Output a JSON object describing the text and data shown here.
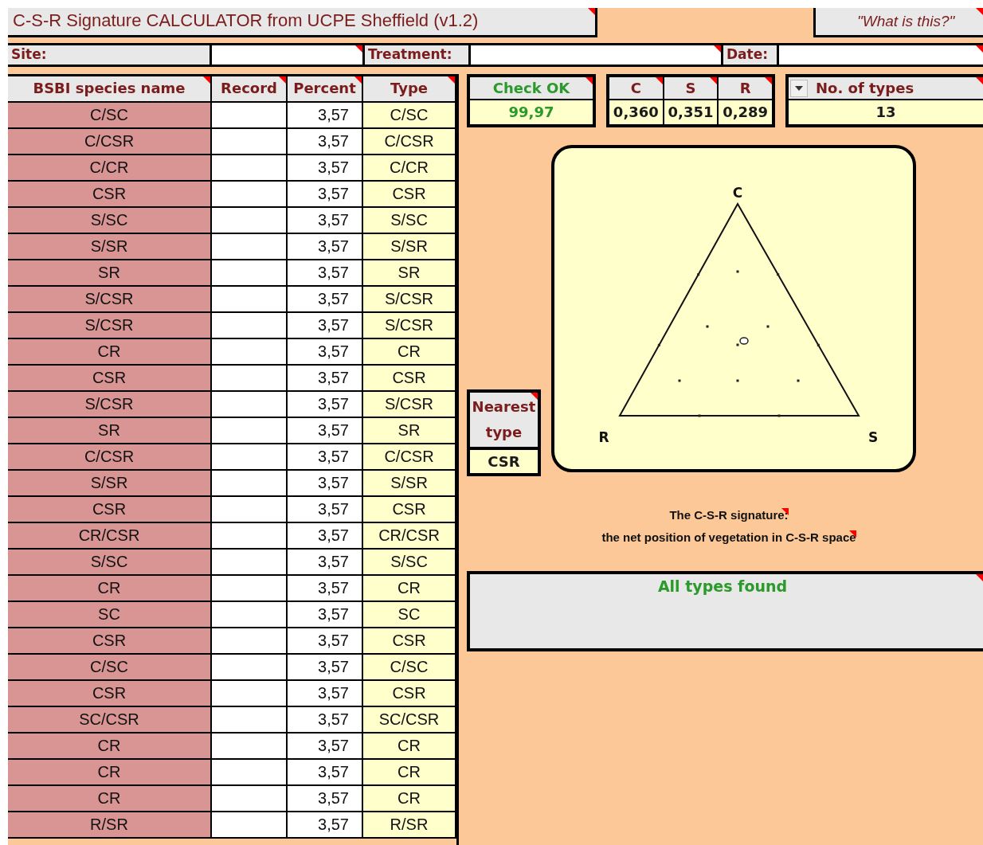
{
  "title": {
    "text": "C-S-R Signature CALCULATOR from UCPE Sheffield (v1.2)",
    "comment": true
  },
  "help_button": {
    "text": "\"What is this?\"",
    "comment": true
  },
  "fields": [
    {
      "label": "Site:",
      "comment": true
    },
    {
      "label": "Treatment:",
      "comment": true
    },
    {
      "label": "Date:",
      "comment": true
    }
  ],
  "table": {
    "columns": [
      {
        "label": "BSBI species name",
        "comment": true
      },
      {
        "label": "Record",
        "comment": true
      },
      {
        "label": "Percent",
        "comment": true
      },
      {
        "label": "Type",
        "comment": true
      }
    ],
    "rows": [
      {
        "name": "C/SC",
        "percent": "3,57",
        "type": "C/SC"
      },
      {
        "name": "C/CSR",
        "percent": "3,57",
        "type": "C/CSR"
      },
      {
        "name": "C/CR",
        "percent": "3,57",
        "type": "C/CR"
      },
      {
        "name": "CSR",
        "percent": "3,57",
        "type": "CSR"
      },
      {
        "name": "S/SC",
        "percent": "3,57",
        "type": "S/SC"
      },
      {
        "name": "S/SR",
        "percent": "3,57",
        "type": "S/SR"
      },
      {
        "name": "SR",
        "percent": "3,57",
        "type": "SR"
      },
      {
        "name": "S/CSR",
        "percent": "3,57",
        "type": "S/CSR"
      },
      {
        "name": "S/CSR",
        "percent": "3,57",
        "type": "S/CSR"
      },
      {
        "name": "CR",
        "percent": "3,57",
        "type": "CR"
      },
      {
        "name": "CSR",
        "percent": "3,57",
        "type": "CSR"
      },
      {
        "name": "S/CSR",
        "percent": "3,57",
        "type": "S/CSR"
      },
      {
        "name": "SR",
        "percent": "3,57",
        "type": "SR"
      },
      {
        "name": "C/CSR",
        "percent": "3,57",
        "type": "C/CSR"
      },
      {
        "name": "S/SR",
        "percent": "3,57",
        "type": "S/SR"
      },
      {
        "name": "CSR",
        "percent": "3,57",
        "type": "CSR"
      },
      {
        "name": "CR/CSR",
        "percent": "3,57",
        "type": "CR/CSR"
      },
      {
        "name": "S/SC",
        "percent": "3,57",
        "type": "S/SC"
      },
      {
        "name": "CR",
        "percent": "3,57",
        "type": "CR"
      },
      {
        "name": "SC",
        "percent": "3,57",
        "type": "SC"
      },
      {
        "name": "CSR",
        "percent": "3,57",
        "type": "CSR"
      },
      {
        "name": "C/SC",
        "percent": "3,57",
        "type": "C/SC"
      },
      {
        "name": "CSR",
        "percent": "3,57",
        "type": "CSR"
      },
      {
        "name": "SC/CSR",
        "percent": "3,57",
        "type": "SC/CSR"
      },
      {
        "name": "CR",
        "percent": "3,57",
        "type": "CR"
      },
      {
        "name": "CR",
        "percent": "3,57",
        "type": "CR"
      },
      {
        "name": "CR",
        "percent": "3,57",
        "type": "CR"
      },
      {
        "name": "R/SR",
        "percent": "3,57",
        "type": "R/SR"
      }
    ]
  },
  "check": {
    "label": "Check OK",
    "value": "99,97",
    "comment": true
  },
  "csr": [
    {
      "label": "C",
      "value": "0,360",
      "comment": true
    },
    {
      "label": "S",
      "value": "0,351",
      "comment": true
    },
    {
      "label": "R",
      "value": "0,289",
      "comment": true
    }
  ],
  "types": {
    "label": "No. of types",
    "value": "13",
    "comment": true
  },
  "nearest": {
    "label": "Nearest type",
    "value": "CSR",
    "comment": true
  },
  "plot": {
    "vertex_labels": [
      "C",
      "R",
      "S"
    ]
  },
  "caption": [
    {
      "text": "The C-S-R signature:",
      "comment": true
    },
    {
      "text": "the net position of vegetation in C-S-R space",
      "comment": true
    }
  ],
  "status": {
    "text": "All types found",
    "comment": true
  }
}
